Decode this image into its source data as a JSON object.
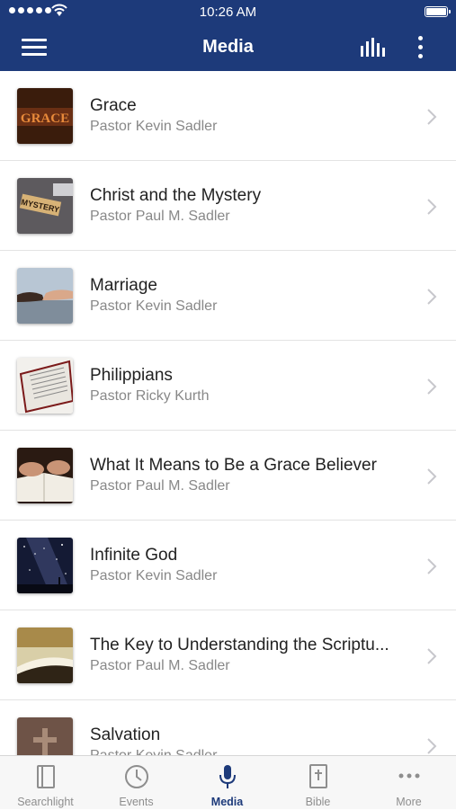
{
  "status_bar": {
    "time": "10:26 AM"
  },
  "header": {
    "title": "Media",
    "menu_icon": "hamburger-menu-icon",
    "audio_icon": "audio-bars-icon",
    "more_icon": "more-vertical-icon"
  },
  "media_list": [
    {
      "title": "Grace",
      "speaker": "Pastor Kevin Sadler",
      "thumbnail": "grace-text-image"
    },
    {
      "title": "Christ and the Mystery",
      "speaker": "Pastor Paul M. Sadler",
      "thumbnail": "mystery-key-tag-image"
    },
    {
      "title": "Marriage",
      "speaker": "Pastor Kevin Sadler",
      "thumbnail": "holding-hands-image"
    },
    {
      "title": "Philippians",
      "speaker": "Pastor Ricky Kurth",
      "thumbnail": "open-bible-image"
    },
    {
      "title": "What It Means to Be a Grace Believer",
      "speaker": "Pastor Paul M. Sadler",
      "thumbnail": "hands-on-bible-image"
    },
    {
      "title": "Infinite God",
      "speaker": "Pastor Kevin Sadler",
      "thumbnail": "starry-sky-image"
    },
    {
      "title": "The Key to Understanding the Scriptu...",
      "speaker": "Pastor Paul M. Sadler",
      "thumbnail": "book-pages-image"
    },
    {
      "title": "Salvation",
      "speaker": "Pastor Kevin Sadler",
      "thumbnail": "cross-image"
    }
  ],
  "tab_bar": {
    "tabs": [
      {
        "label": "Searchlight",
        "icon": "searchlight-icon"
      },
      {
        "label": "Events",
        "icon": "clock-icon"
      },
      {
        "label": "Media",
        "icon": "microphone-icon"
      },
      {
        "label": "Bible",
        "icon": "bible-icon"
      },
      {
        "label": "More",
        "icon": "more-dots-icon"
      }
    ],
    "active_tab": "Media"
  },
  "colors": {
    "nav_bar": "#1d3a7a",
    "active_tab": "#1d3a7a",
    "inactive_tab": "#8e8e8e"
  }
}
